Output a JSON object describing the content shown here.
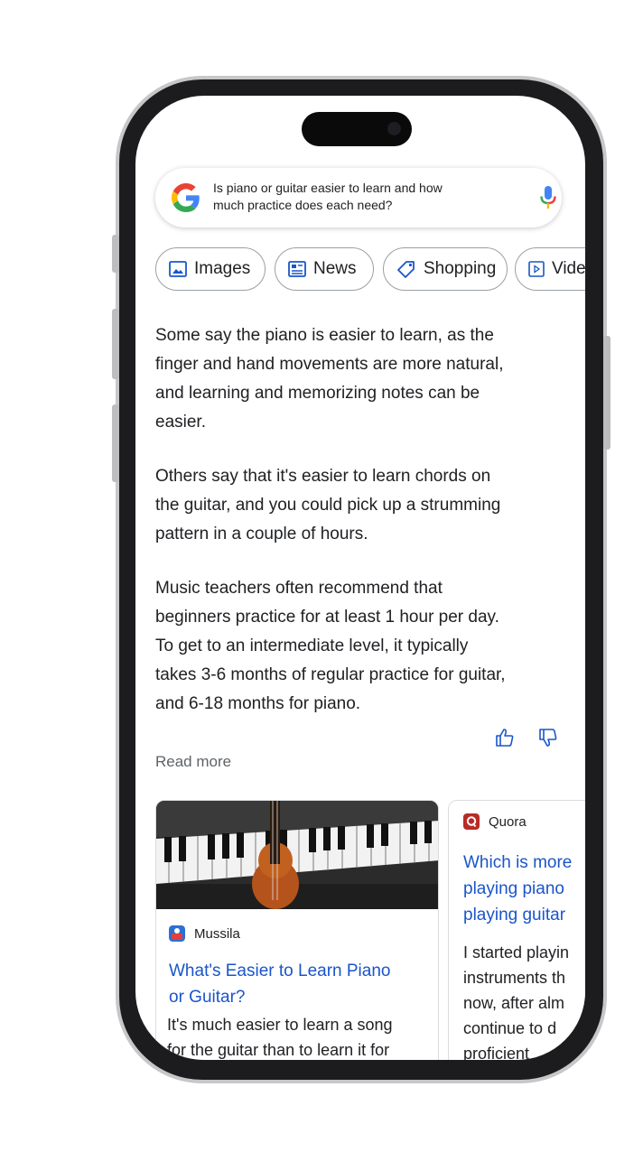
{
  "search": {
    "query_line1": "Is piano or guitar easier to learn and how",
    "query_line2": "much practice does each need?"
  },
  "chips": [
    {
      "label": "Images",
      "icon": "image-icon"
    },
    {
      "label": "News",
      "icon": "news-icon"
    },
    {
      "label": "Shopping",
      "icon": "tag-icon"
    },
    {
      "label": "Vide",
      "icon": "video-icon"
    }
  ],
  "overview": {
    "para1": [
      "Some say the piano is easier to learn, as the",
      "finger and hand movements are more natural,",
      "and learning and memorizing notes can be",
      "easier."
    ],
    "para2": [
      "Others say that it's easier to learn chords on",
      "the guitar, and you could pick up a strumming",
      "pattern in a couple of hours."
    ],
    "para3": [
      "Music teachers often recommend that",
      "beginners practice for at least 1 hour per day.",
      "To get to an intermediate level, it typically",
      "takes 3-6 months of regular practice for guitar,",
      "and 6-18 months for piano."
    ]
  },
  "read_more": "Read more",
  "cards": [
    {
      "source": "Mussila",
      "title_line1": "What's Easier to Learn Piano",
      "title_line2": "or Guitar?",
      "snippet_line1": "It's much easier to learn a song",
      "snippet_line2": "for the guitar than to learn it for"
    },
    {
      "source": "Quora",
      "title_line1": "Which is more",
      "title_line2": "playing piano",
      "title_line3": "playing guitar",
      "snippet_line1": "I started playin",
      "snippet_line2": "instruments th",
      "snippet_line3": "now, after alm",
      "snippet_line4": "continue to d",
      "snippet_line5": "proficient"
    }
  ],
  "colors": {
    "link": "#1a55c9",
    "google_blue": "#4285f4",
    "google_red": "#ea4335",
    "google_yellow": "#fbbc05",
    "google_green": "#34a853"
  }
}
